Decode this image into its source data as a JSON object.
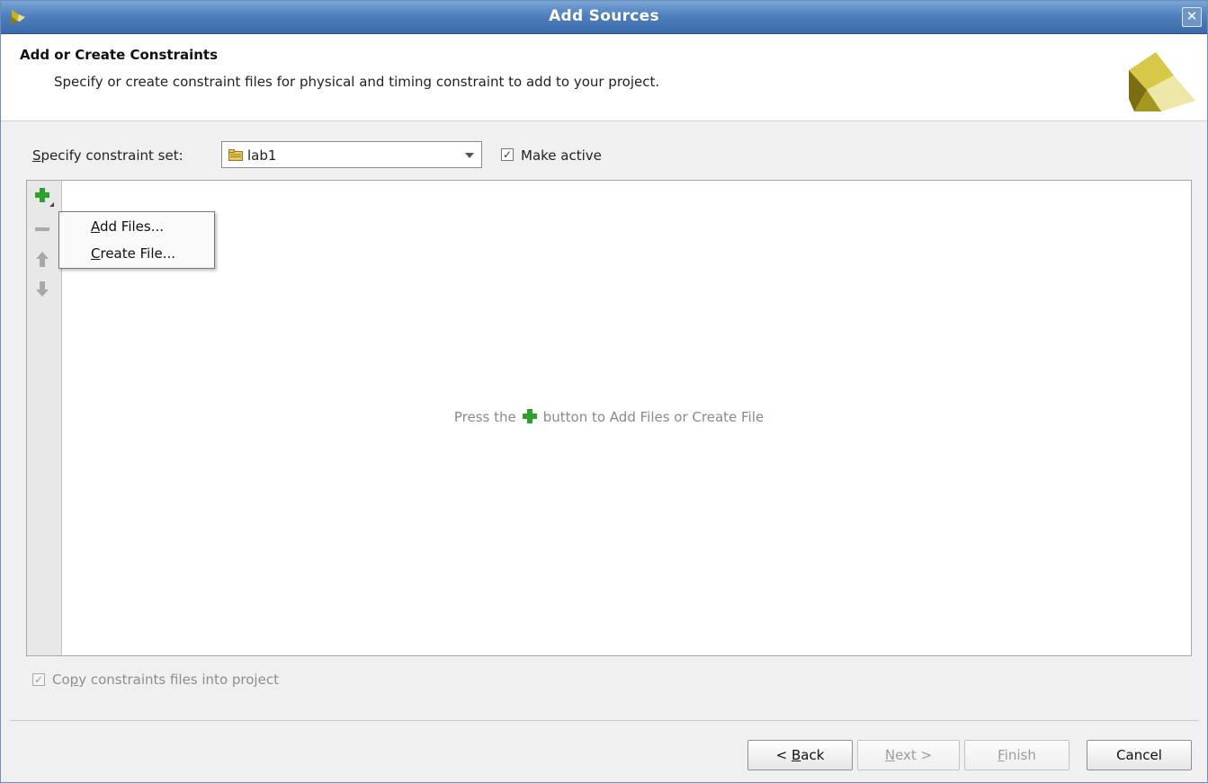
{
  "window": {
    "title": "Add Sources"
  },
  "header": {
    "title": "Add or Create Constraints",
    "subtitle": "Specify or create constraint files for physical and timing constraint to add to your project."
  },
  "constraint_set": {
    "label_mnemonic": "S",
    "label_rest": "pecify constraint set:",
    "value": "lab1",
    "make_active_label": "Make active",
    "make_active_checked": true
  },
  "toolbar": {
    "icons": [
      "add-icon",
      "remove-icon",
      "move-up-icon",
      "move-down-icon"
    ]
  },
  "add_menu": {
    "items": [
      {
        "mnemonic": "A",
        "rest": "dd Files..."
      },
      {
        "mnemonic": "C",
        "rest": "reate File..."
      }
    ]
  },
  "empty_message": {
    "before": "Press the",
    "after": "button to Add Files or Create File"
  },
  "copy_option": {
    "label_pre": "Co",
    "label_mnemonic": "p",
    "label_post": "y constraints files into project",
    "checked": true,
    "enabled": false
  },
  "buttons": {
    "back": {
      "pre": "< ",
      "mnemonic": "B",
      "rest": "ack"
    },
    "next": {
      "mnemonic": "N",
      "rest": "ext >"
    },
    "finish": {
      "mnemonic": "F",
      "rest": "inish"
    },
    "cancel": {
      "label": "Cancel"
    }
  },
  "colors": {
    "title_bar": "#4f7fbd",
    "add_green": "#2ea02e",
    "disabled_text": "#9c9c9c"
  }
}
